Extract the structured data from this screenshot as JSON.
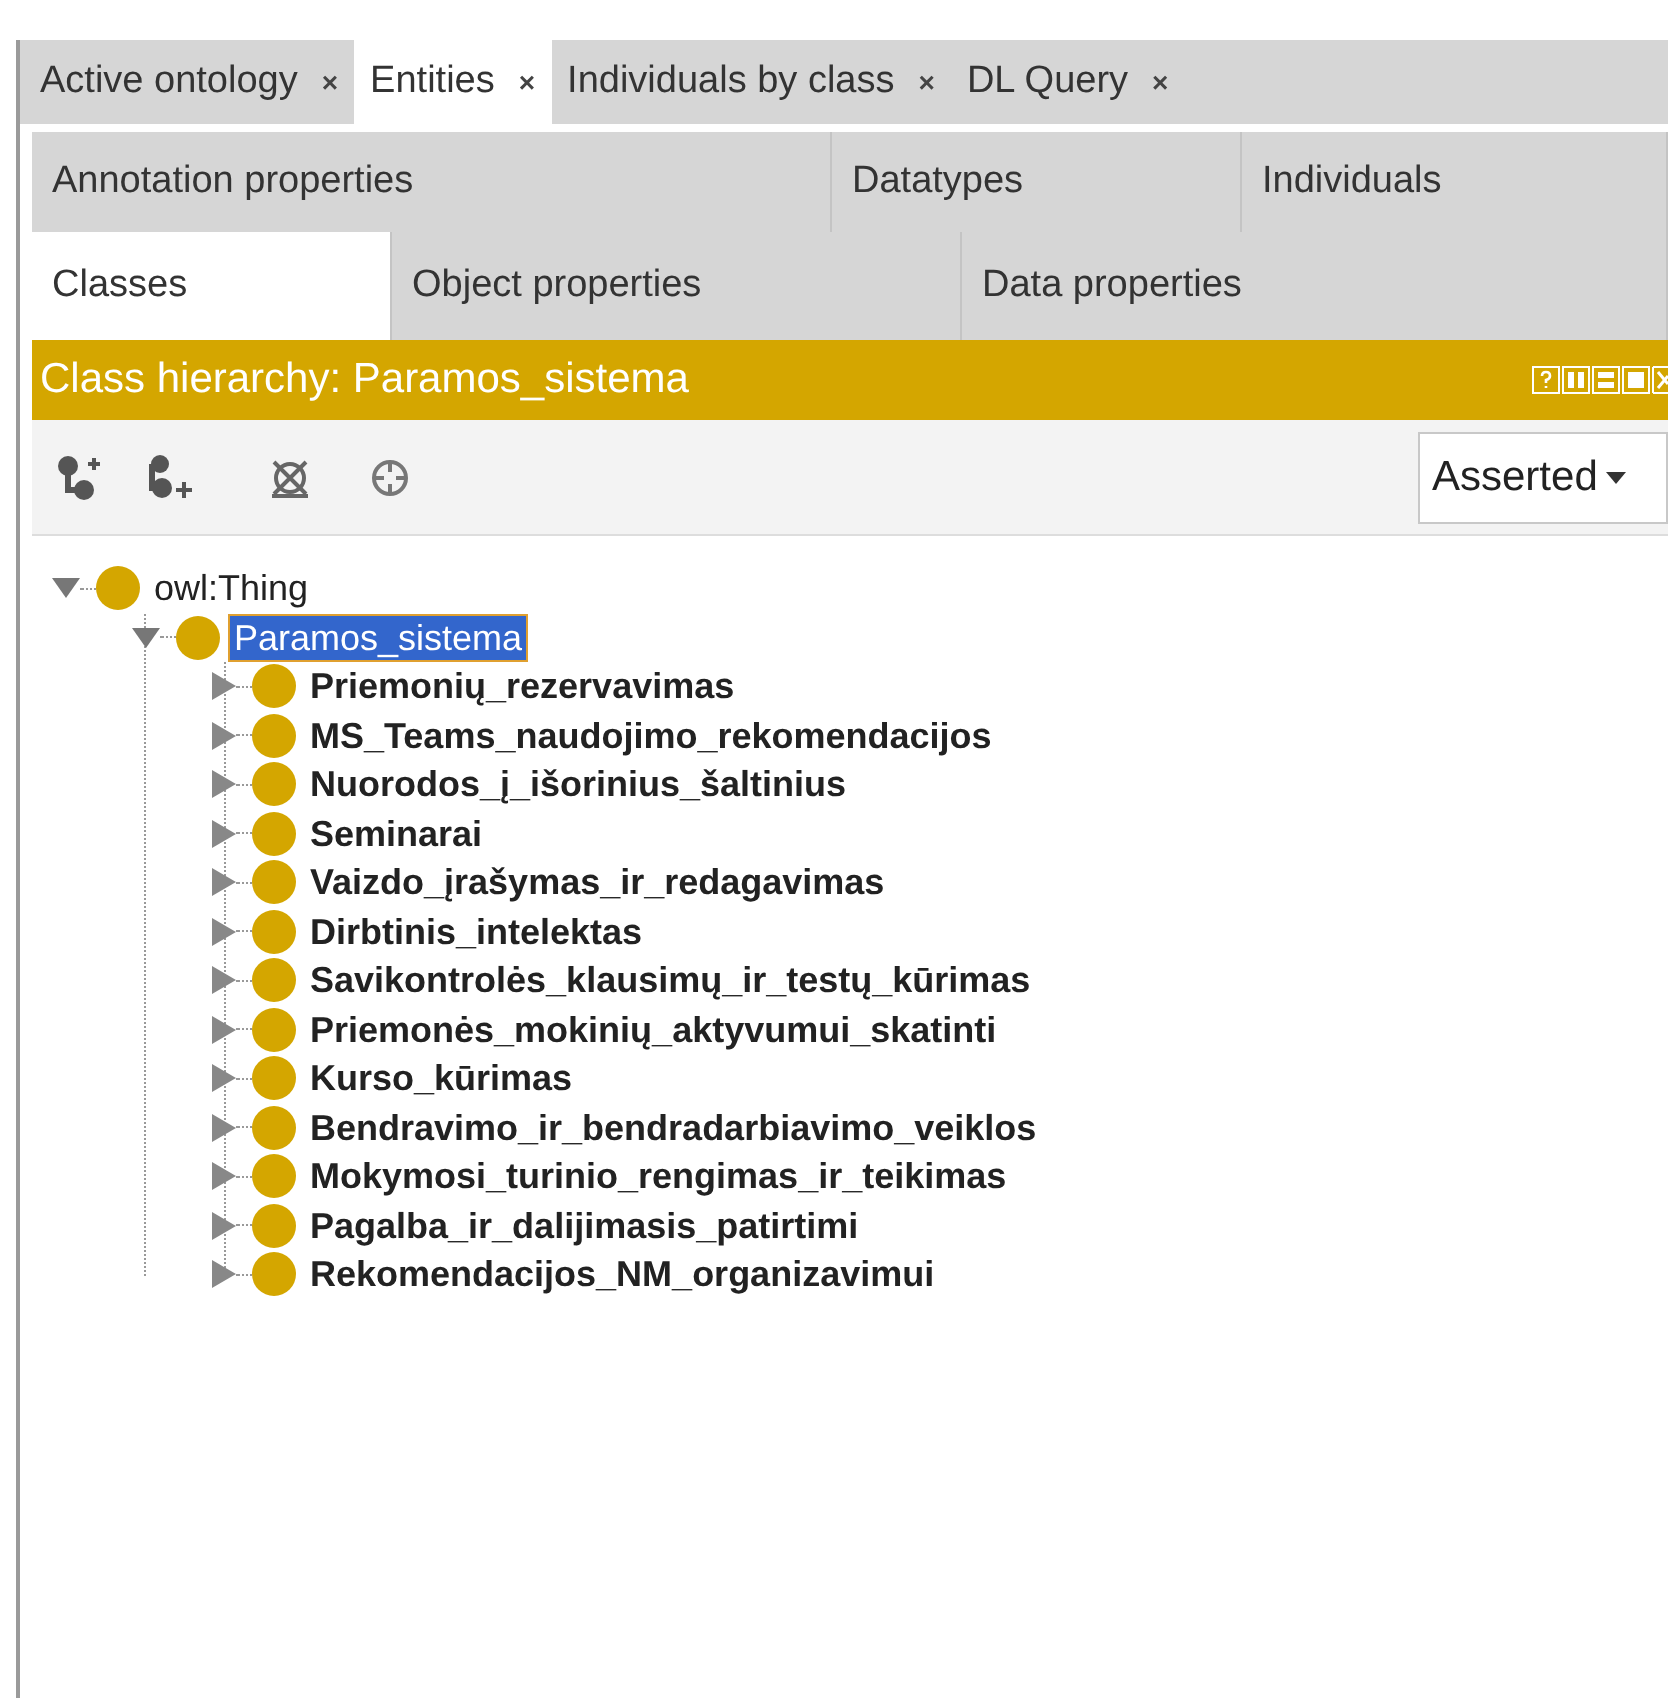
{
  "tabs": [
    {
      "label": "Active ontology",
      "close": "×",
      "selected": false
    },
    {
      "label": "Entities",
      "close": "×",
      "selected": true
    },
    {
      "label": "Individuals by class",
      "close": "×",
      "selected": false
    },
    {
      "label": "DL Query",
      "close": "×",
      "selected": false
    }
  ],
  "entity_tabs_row_1": [
    {
      "label": "Annotation properties",
      "selected": false
    },
    {
      "label": "Datatypes",
      "selected": false
    },
    {
      "label": "Individuals",
      "selected": false
    }
  ],
  "entity_tabs_row_2": [
    {
      "label": "Classes",
      "selected": true
    },
    {
      "label": "Object properties",
      "selected": false
    },
    {
      "label": "Data properties",
      "selected": false
    }
  ],
  "panel": {
    "title": "Class hierarchy: Paramos_sistema",
    "view_mode": "Asserted"
  },
  "tree": [
    {
      "label": "owl:Thing",
      "expanded": true,
      "selected": false,
      "children": [
        {
          "label": "Paramos_sistema",
          "expanded": true,
          "selected": true,
          "children": [
            {
              "label": "Priemonių_rezervavimas",
              "expanded": false,
              "selected": false
            },
            {
              "label": "MS_Teams_naudojimo_rekomendacijos",
              "expanded": false,
              "selected": false
            },
            {
              "label": "Nuorodos_į_išorinius_šaltinius",
              "expanded": false,
              "selected": false
            },
            {
              "label": "Seminarai",
              "expanded": false,
              "selected": false
            },
            {
              "label": "Vaizdo_įrašymas_ir_redagavimas",
              "expanded": false,
              "selected": false
            },
            {
              "label": "Dirbtinis_intelektas",
              "expanded": false,
              "selected": false
            },
            {
              "label": "Savikontrolės_klausimų_ir_testų_kūrimas",
              "expanded": false,
              "selected": false
            },
            {
              "label": "Priemonės_mokinių_aktyvumui_skatinti",
              "expanded": false,
              "selected": false
            },
            {
              "label": "Kurso_kūrimas",
              "expanded": false,
              "selected": false
            },
            {
              "label": "Bendravimo_ir_bendradarbiavimo_veiklos",
              "expanded": false,
              "selected": false
            },
            {
              "label": "Mokymosi_turinio_rengimas_ir_teikimas",
              "expanded": false,
              "selected": false
            },
            {
              "label": "Pagalba_ir_dalijimasis_patirtimi",
              "expanded": false,
              "selected": false
            },
            {
              "label": "Rekomendacijos_NM_organizavimui",
              "expanded": false,
              "selected": false
            }
          ]
        }
      ]
    }
  ]
}
